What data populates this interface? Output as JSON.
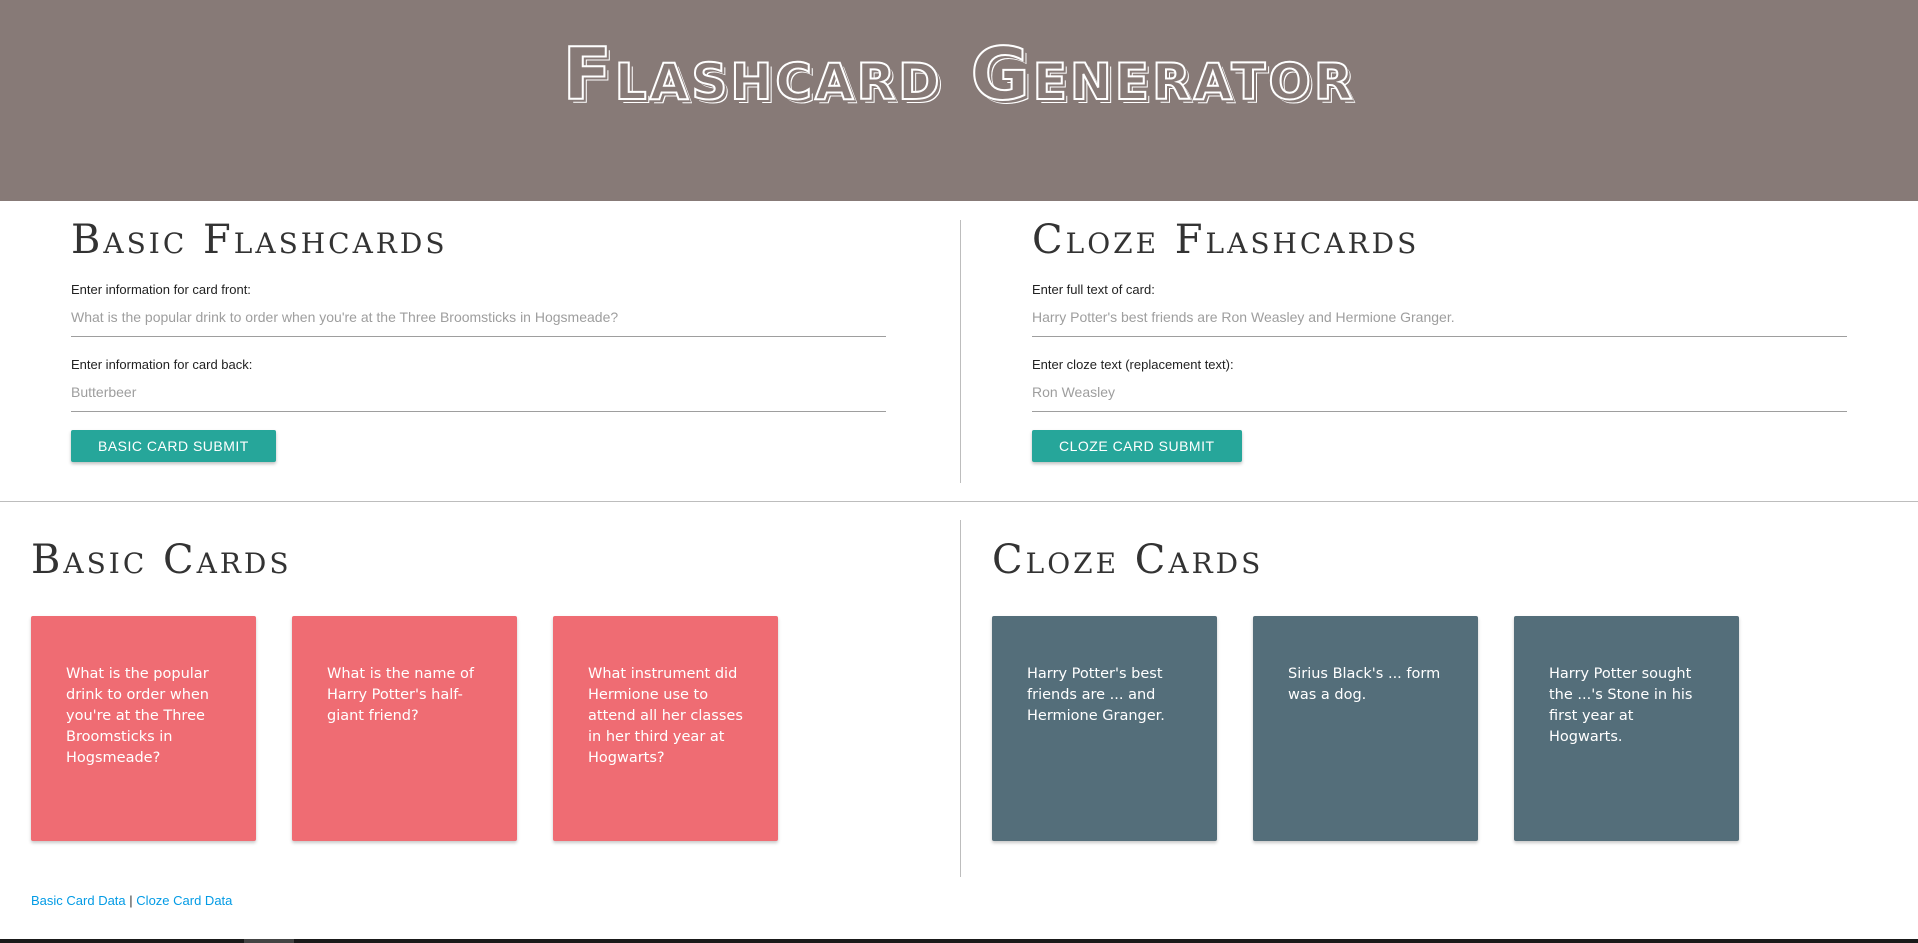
{
  "header": {
    "title": "Flashcard Generator",
    "background_color": "#877a77"
  },
  "basic_form": {
    "title": "Basic Flashcards",
    "front_label": "Enter information for card front:",
    "front_placeholder": "What is the popular drink to order when you're at the Three Broomsticks in Hogsmeade?",
    "back_label": "Enter information for card back:",
    "back_placeholder": "Butterbeer",
    "submit_label": "BASIC CARD SUBMIT"
  },
  "cloze_form": {
    "title": "Cloze Flashcards",
    "full_text_label": "Enter full text of card:",
    "full_text_placeholder": "Harry Potter's best friends are Ron Weasley and Hermione Granger.",
    "cloze_label": "Enter cloze text (replacement text):",
    "cloze_placeholder": "Ron Weasley",
    "submit_label": "CLOZE CARD SUBMIT"
  },
  "basic_cards": {
    "title": "Basic Cards",
    "color": "#ef6c73",
    "cards": [
      {
        "text": "What is the popular drink to order when you're at the Three Broomsticks in Hogsmeade?"
      },
      {
        "text": "What is the name of Harry Potter's half-giant friend?"
      },
      {
        "text": "What instrument did Hermione use to attend all her classes in her third year at Hogwarts?"
      }
    ]
  },
  "cloze_cards": {
    "title": "Cloze Cards",
    "color": "#546e7a",
    "cards": [
      {
        "text": "Harry Potter's best friends are ... and Hermione Granger."
      },
      {
        "text": "Sirius Black's ... form was a dog."
      },
      {
        "text": "Harry Potter sought the ...'s Stone in his first year at Hogwarts."
      }
    ]
  },
  "footer": {
    "basic_link": "Basic Card Data",
    "separator": "|",
    "cloze_link": "Cloze Card Data"
  },
  "accent_color": "#26a69a",
  "link_color": "#039be5"
}
